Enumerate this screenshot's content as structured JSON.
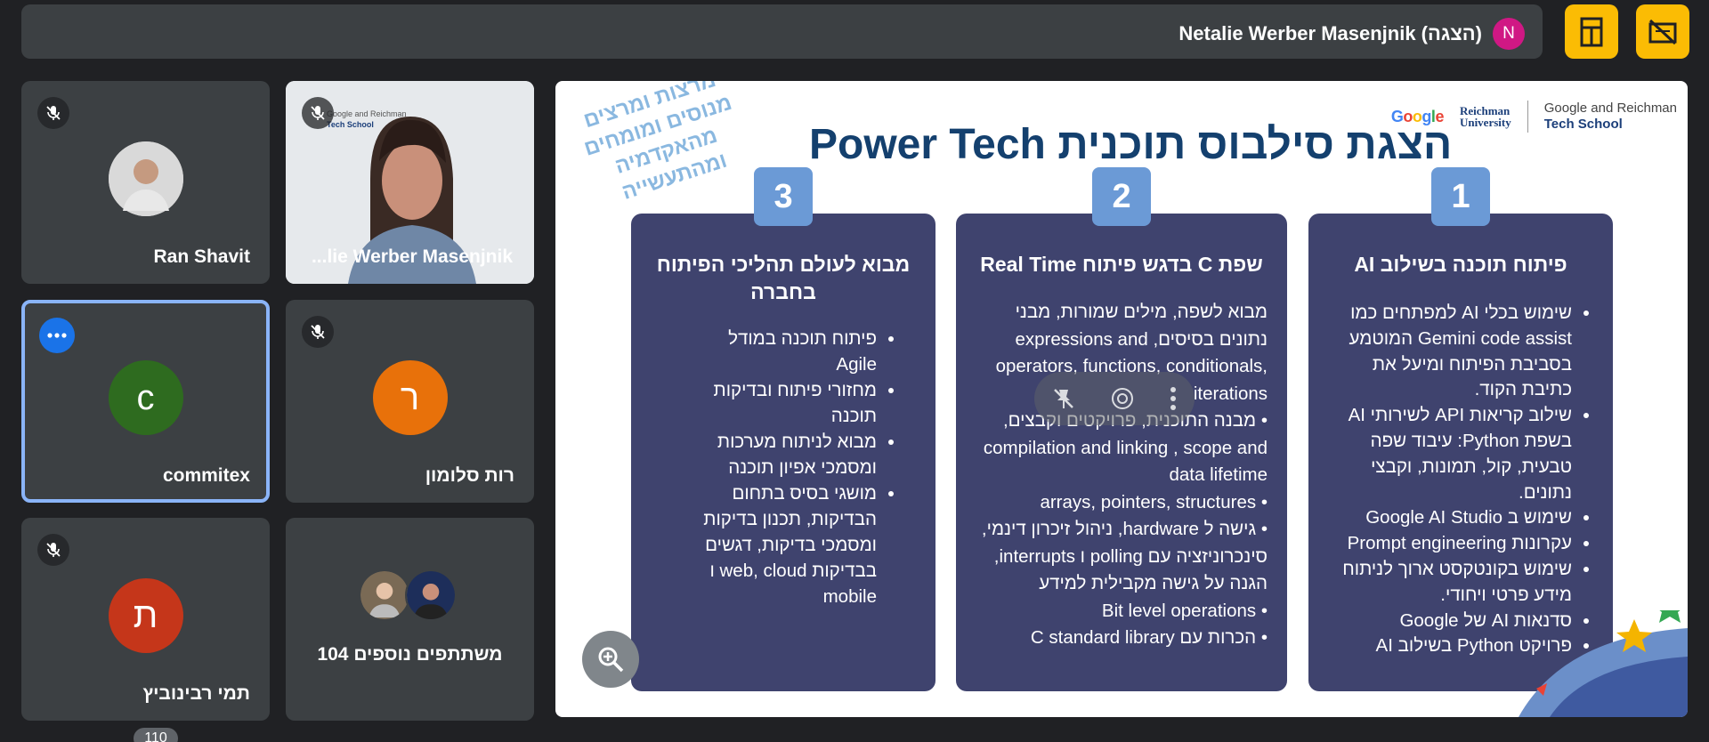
{
  "meeting": {
    "presenter_label": "Netalie Werber Masenjnik (הצגה)",
    "presenter_initial": "N",
    "presenter_color": "#d01884"
  },
  "top_buttons": [
    {
      "name": "room-icon"
    },
    {
      "name": "stop-presenting-icon"
    }
  ],
  "participants": [
    {
      "name": "Ran Shavit",
      "type": "photo",
      "muted": true
    },
    {
      "name": "...lie Werber Masenjnik",
      "type": "video",
      "muted": true
    },
    {
      "name": "commitex",
      "initial": "c",
      "color": "#2e6b1f",
      "muted": false,
      "active": true
    },
    {
      "name": "רות סלומון",
      "initial": "ר",
      "color": "#e8710a",
      "muted": true
    },
    {
      "name": "תמי רבינוביץ",
      "initial": "ת",
      "color": "#c5361a",
      "muted": true
    },
    {
      "name": "104 משתתפים נוספים",
      "type": "others"
    }
  ],
  "participant_count_badge": "110",
  "slide": {
    "title": "הצגת סילבוס תוכנית Power Tech",
    "stamp_lines": [
      "מרצות ומרצים",
      "מנוסים ומומחים",
      "מהאקדמיה ומהתעשייה"
    ],
    "brand_google": "Google",
    "brand_reichman_line1": "Reichman",
    "brand_reichman_line2": "University",
    "brand_school_line1": "Google and Reichman",
    "brand_school_line2": "Tech School",
    "columns": [
      {
        "number": "1",
        "title": "פיתוח תוכנה בשילוב AI",
        "items": [
          "שימוש בכלי AI למפתחים כמו Gemini code assist המוטמע בסביבת הפיתוח ומיעל את כתיבת הקוד.",
          "שילוב קריאות API לשירותי AI בשפת Python: עיבוד שפה טבעית, קול, תמונות, וקבצי נתונים.",
          "שימוש ב Google AI Studio",
          "עקרונות Prompt engineering",
          "שימוש בקונטקסט ארוך לניתוח מידע פרטי ויחודי.",
          "סדנאות AI של Google",
          "פרויקט Python בשילוב AI"
        ]
      },
      {
        "number": "2",
        "title": "שפת C בדגש פיתוח Real Time",
        "items": [
          "מבוא לשפה, מילים שמורות, מבני נתונים בסיסים, expressions and operators, functions, conditionals, iterations",
          "• מבנה התוכנית, פרויקטים וקבצים, compilation and linking , scope and data lifetime",
          "• arrays, pointers, structures",
          "• גישה ל hardware, ניהול זיכרון דינמי, סינכרוניזציה עם polling ו interrupts, הגנה על גישה מקבילית למידע",
          "• Bit level operations",
          "• הכרות עם C standard library"
        ]
      },
      {
        "number": "3",
        "title": "מבוא לעולם תהליכי הפיתוח בחברה",
        "items": [
          "פיתוח תוכנה במודל Agile",
          "מחזורי פיתוח ובדיקות תוכנה",
          "מבוא לניתוח מערכות ומסמכי אפיון תוכנה",
          "מושגי בסיס בתחום הבדיקות, תכנון בדיקות ומסמכי בדיקות, דגשים בבדיקות web, cloud ו mobile"
        ]
      }
    ]
  }
}
